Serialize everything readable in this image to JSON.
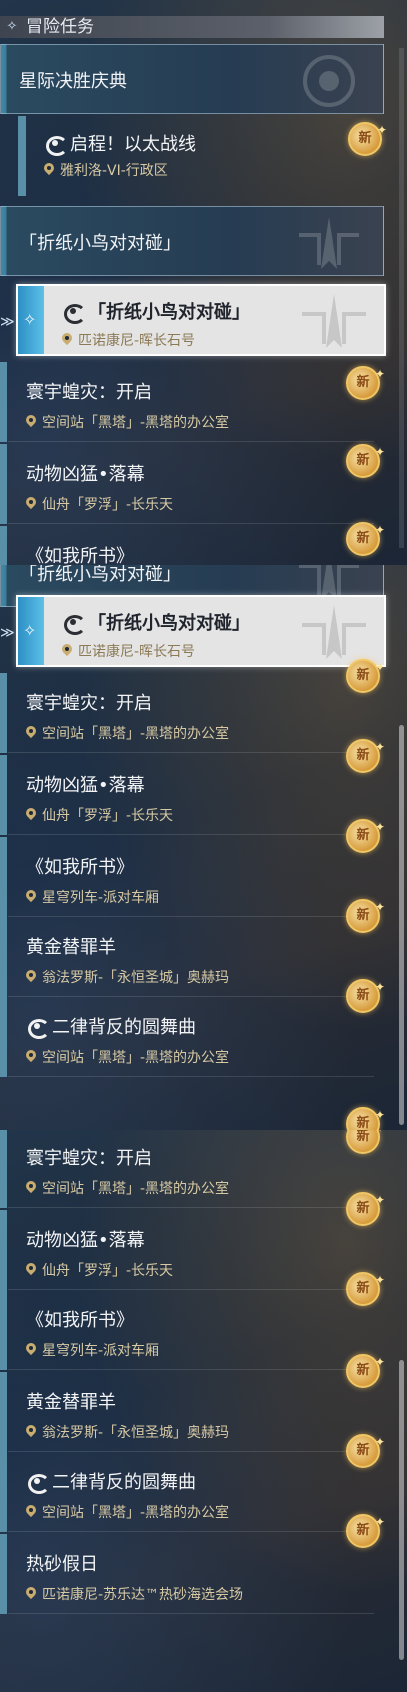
{
  "header": {
    "title": "冒险任务"
  },
  "badge_label": "新",
  "section_star": "星际决胜庆典",
  "section_paper": "「折纸小鸟对对碰」",
  "quests": {
    "ether": {
      "title": "启程！以太战线",
      "location": "雅利洛-VI-行政区"
    },
    "paper": {
      "title": "「折纸小鸟对对碰」",
      "location": "匹诺康尼-晖长石号"
    },
    "locust": {
      "title": "寰宇蝗灾：开启",
      "location": "空间站「黑塔」-黑塔的办公室"
    },
    "beast": {
      "title": "动物凶猛•落幕",
      "location": "仙舟「罗浮」-长乐天"
    },
    "book": {
      "title": "《如我所书》",
      "location": "星穹列车-派对车厢"
    },
    "goat": {
      "title": "黄金替罪羊",
      "location": "翁法罗斯-「永恒圣城」奥赫玛"
    },
    "waltz": {
      "title": "二律背反的圆舞曲",
      "location": "空间站「黑塔」-黑塔的办公室"
    },
    "sand": {
      "title": "热砂假日",
      "location": "匹诺康尼-苏乐达™热砂海选会场"
    }
  }
}
